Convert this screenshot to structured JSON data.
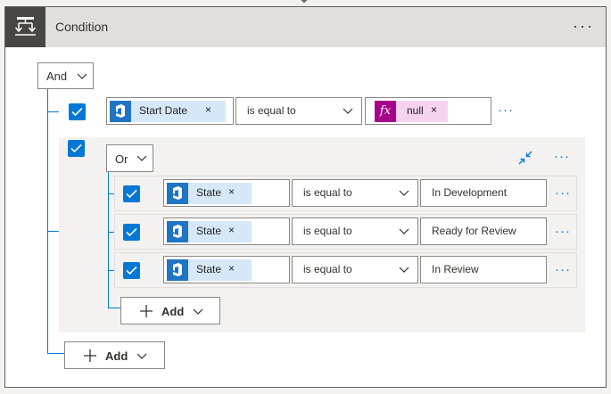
{
  "card": {
    "title": "Condition",
    "more": "···"
  },
  "root_group": {
    "operator": "And",
    "rows": [
      {
        "token_label": "Start Date",
        "token_remove": "×",
        "operator_label": "is equal to",
        "value_token_icon": "fx",
        "value_token_label": "null",
        "value_token_remove": "×",
        "more": "···"
      }
    ],
    "add_label": "Add"
  },
  "nested_group": {
    "operator": "Or",
    "more": "···",
    "rows": [
      {
        "token_label": "State",
        "token_remove": "×",
        "operator_label": "is equal to",
        "value": "In Development",
        "more": "···"
      },
      {
        "token_label": "State",
        "token_remove": "×",
        "operator_label": "is equal to",
        "value": "Ready for Review",
        "more": "···"
      },
      {
        "token_label": "State",
        "token_remove": "×",
        "operator_label": "is equal to",
        "value": "In Review",
        "more": "···"
      }
    ],
    "add_label": "Add"
  },
  "colors": {
    "accent": "#0078d4",
    "header_bg": "#e1dfdd",
    "header_icon_bg": "#484644",
    "token_bg": "#d6e8f7",
    "fx_token_bg": "#f5d3ef",
    "fx_icon_bg": "#a8008a",
    "group_bg": "#f3f2f1"
  }
}
